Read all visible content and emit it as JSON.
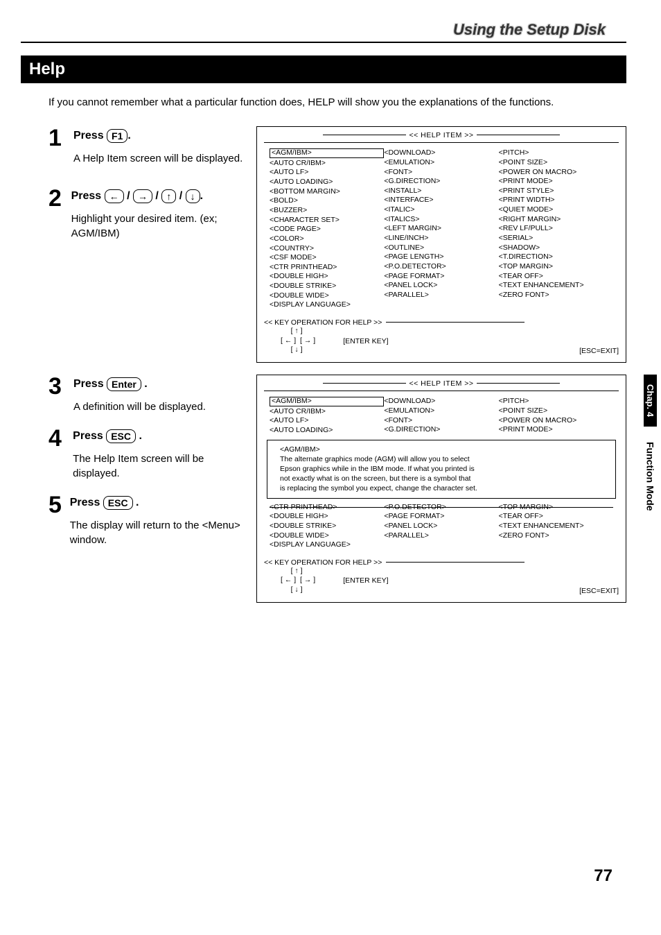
{
  "headerTitle": "Using the Setup Disk",
  "helpBar": "Help",
  "intro": "If you cannot remember what a particular function does, HELP will show you the explanations of the functions.",
  "steps": [
    {
      "num": "1",
      "pressLabel": "Press",
      "key": "F1",
      "suffix": ".",
      "desc": "A Help Item screen will be displayed."
    },
    {
      "num": "2",
      "pressLabel": "Press",
      "arrows": true,
      "suffix": ".",
      "desc": "Highlight your desired item. (ex; AGM/IBM)"
    },
    {
      "num": "3",
      "pressLabel": "Press",
      "key": "Enter",
      "suffix": " .",
      "desc": "A definition will be displayed."
    },
    {
      "num": "4",
      "pressLabel": "Press",
      "key": "ESC",
      "suffix": " .",
      "desc": "The Help Item screen will be displayed."
    },
    {
      "num": "5",
      "pressLabel": "Press",
      "key": "ESC",
      "suffix": " .",
      "desc": "The display will return to the <Menu> window."
    }
  ],
  "screenTitle": "<<  HELP ITEM  >>",
  "col1": [
    "<AGM/IBM>",
    "<AUTO CR/IBM>",
    "<AUTO LF>",
    "<AUTO LOADING>",
    "<BOTTOM MARGIN>",
    "<BOLD>",
    "<BUZZER>",
    "<CHARACTER SET>",
    "<CODE PAGE>",
    "<COLOR>",
    "<COUNTRY>",
    "<CSF MODE>",
    "<CTR PRINTHEAD>",
    "<DOUBLE HIGH>",
    "<DOUBLE STRIKE>",
    "<DOUBLE WIDE>",
    "<DISPLAY LANGUAGE>"
  ],
  "col2": [
    "<DOWNLOAD>",
    "<EMULATION>",
    "<FONT>",
    "<G.DIRECTION>",
    "<INSTALL>",
    "<INTERFACE>",
    "<ITALIC>",
    "<ITALICS>",
    "<LEFT MARGIN>",
    "<LINE/INCH>",
    "<OUTLINE>",
    "<PAGE LENGTH>",
    "<P.O.DETECTOR>",
    "<PAGE FORMAT>",
    "<PANEL LOCK>",
    "<PARALLEL>"
  ],
  "col3": [
    "<PITCH>",
    "<POINT SIZE>",
    "<POWER ON MACRO>",
    "<PRINT MODE>",
    "<PRINT STYLE>",
    "<PRINT WIDTH>",
    "<QUIET MODE>",
    "<RIGHT MARGIN>",
    "<REV LF/PULL>",
    "<SERIAL>",
    "<SHADOW>",
    "<T.DIRECTION>",
    "<TOP MARGIN>",
    "<TEAR OFF>",
    "<TEXT ENHANCEMENT>",
    "<ZERO FONT>"
  ],
  "keyOpTitle": "<<  KEY OPERATION FOR HELP  >>",
  "keyOpLines": "     [ ↑ ]\n[ ← ]  [ → ]\n     [ ↓ ]",
  "enterKey": "[ENTER KEY]",
  "escExit": "[ESC=EXIT]",
  "screen2": {
    "topCol1": [
      "<AGM/IBM>",
      "<AUTO CR/IBM>",
      "<AUTO LF>",
      "<AUTO LOADING>"
    ],
    "topCol2": [
      "<DOWNLOAD>",
      "<EMULATION>",
      "<FONT>",
      "<G.DIRECTION>"
    ],
    "topCol3": [
      "<PITCH>",
      "<POINT SIZE>",
      "<POWER ON MACRO>",
      "<PRINT MODE>"
    ],
    "defTitle": "<AGM/IBM>",
    "defBody1": "The alternate graphics mode (AGM) will allow you to select",
    "defBody2": "Epson graphics while in the IBM mode. If what you printed is",
    "defBody3": "not exactly what is on the screen, but there is a symbol that",
    "defBody4": "is replacing the symbol you expect, change the character set.",
    "botCol1": [
      "<CTR PRINTHEAD>",
      "<DOUBLE HIGH>",
      "<DOUBLE STRIKE>",
      "<DOUBLE WIDE>",
      "<DISPLAY LANGUAGE>"
    ],
    "botCol2": [
      "<P.O.DETECTOR>",
      "<PAGE FORMAT>",
      "<PANEL LOCK>",
      "<PARALLEL>"
    ],
    "botCol3": [
      "<TOP MARGIN>",
      "<TEAR OFF>",
      "<TEXT ENHANCEMENT>",
      "<ZERO FONT>"
    ]
  },
  "sideTabBlack": "Chap. 4",
  "sideTabWhite": "Function Mode",
  "pageNum": "77"
}
